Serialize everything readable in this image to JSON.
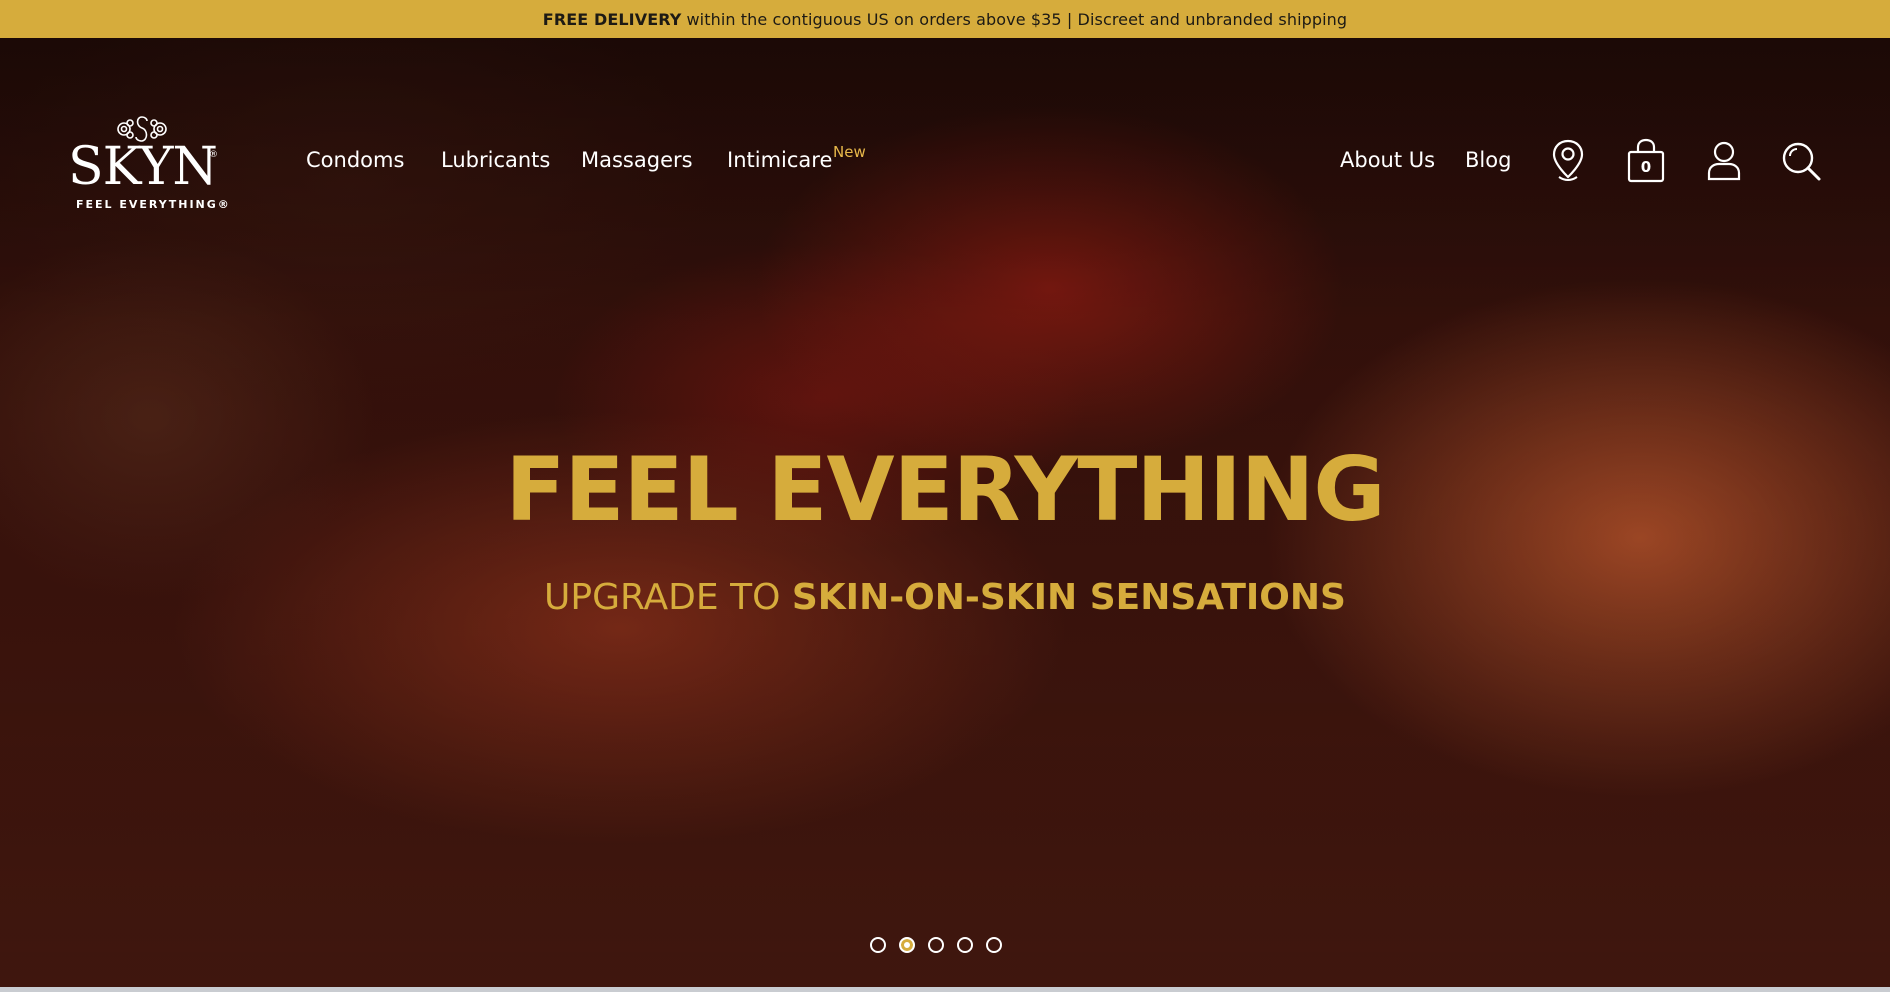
{
  "announcement": {
    "bold": "FREE DELIVERY",
    "text": "within the contiguous US on orders above $35 | Discreet and unbranded shipping"
  },
  "brand": {
    "name": "SKYN",
    "registered": "®",
    "tagline": "FEEL EVERYTHING®"
  },
  "nav": {
    "items": [
      {
        "label": "Condoms"
      },
      {
        "label": "Lubricants"
      },
      {
        "label": "Massagers"
      },
      {
        "label": "Intimicare"
      }
    ],
    "new_badge": "New",
    "about": "About Us",
    "blog": "Blog"
  },
  "icons": {
    "store_locator": "map-pin-icon",
    "cart": "shopping-bag-icon",
    "account": "user-icon",
    "search": "search-icon"
  },
  "cart": {
    "count": "0"
  },
  "hero": {
    "headline": "FEEL EVERYTHING",
    "sub_prefix": "UPGRADE TO",
    "sub_strong": "SKIN-ON-SKIN SENSATIONS"
  },
  "carousel": {
    "slides": 5,
    "active_index": 1
  },
  "colors": {
    "accent_gold": "#d6ac3c",
    "badge_gold": "#e8b84a",
    "text_light": "#ffffff"
  }
}
